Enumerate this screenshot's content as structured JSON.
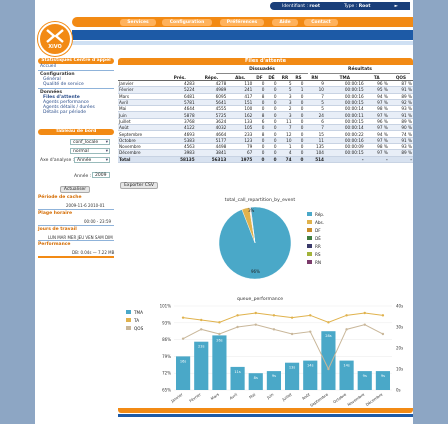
{
  "header": {
    "identified_label": "Identifiant :",
    "identified_user": "root",
    "type_label": "Type :",
    "type_value": "Root",
    "logo_text": "XiVO",
    "nav": [
      "Services",
      "Configuration",
      "Préférences",
      "Aide",
      "Contact"
    ]
  },
  "sidebar": {
    "title": "Statistiques Centre d'appel",
    "sections": [
      {
        "label": "Accueil",
        "items": []
      },
      {
        "label": "Configuration",
        "items": [
          "Général",
          "Qualité de service"
        ]
      },
      {
        "label": "Données",
        "items": [
          "Files d'attente",
          "Agents performance",
          "Agents détails / durées",
          "Détails par période"
        ]
      }
    ],
    "dashboard_title": "Tableau de bord",
    "conf_select": "conf_locale",
    "axis_select": "normal",
    "year_label": "Axe d'analyse :",
    "year_select": "Année",
    "annee_label": "Année :",
    "annee_value": "2009",
    "apply_button": "Actualiser",
    "info": [
      {
        "title": "Période de cache",
        "value": "2009-11-6 2010-01"
      },
      {
        "title": "Plage horaire",
        "value": "00:00 - 23:59"
      },
      {
        "title": "Jours de travail",
        "value": "LUN MAR MER JEU VEN SAM DIM"
      },
      {
        "title": "Performance",
        "value": "DB: 0.04s — 7.22 MB"
      }
    ]
  },
  "table": {
    "title": "Files d'attente",
    "group_headers": [
      "Dissuadés",
      "Résultats"
    ],
    "columns": [
      "",
      "Prés.",
      "Répo.",
      "Abs.",
      "DF",
      "DÉ",
      "RR",
      "RS",
      "RN",
      "TMA",
      "TA",
      "QOS"
    ],
    "rows": [
      [
        "Janvier",
        "4283",
        "4278",
        "110",
        "0",
        "0",
        "5",
        "0",
        "9",
        "00:00:16",
        "96 %",
        "87 %"
      ],
      [
        "Février",
        "5224",
        "4989",
        "241",
        "0",
        "0",
        "5",
        "1",
        "10",
        "00:00:15",
        "95 %",
        "91 %"
      ],
      [
        "Mars",
        "6481",
        "6095",
        "417",
        "8",
        "0",
        "3",
        "0",
        "7",
        "00:00:16",
        "94 %",
        "89 %"
      ],
      [
        "Avril",
        "5781",
        "5641",
        "151",
        "0",
        "0",
        "3",
        "0",
        "5",
        "00:00:15",
        "97 %",
        "92 %"
      ],
      [
        "Mai",
        "4644",
        "4555",
        "100",
        "0",
        "0",
        "2",
        "0",
        "5",
        "00:00:14",
        "98 %",
        "93 %"
      ],
      [
        "Juin",
        "5878",
        "5725",
        "162",
        "8",
        "0",
        "3",
        "0",
        "24",
        "00:00:11",
        "97 %",
        "91 %"
      ],
      [
        "Juillet",
        "3768",
        "3624",
        "133",
        "6",
        "0",
        "11",
        "0",
        "6",
        "00:00:15",
        "96 %",
        "89 %"
      ],
      [
        "Août",
        "4122",
        "4032",
        "105",
        "0",
        "0",
        "7",
        "0",
        "7",
        "00:00:14",
        "97 %",
        "90 %"
      ],
      [
        "Septembre",
        "4693",
        "4664",
        "233",
        "8",
        "0",
        "12",
        "0",
        "15",
        "00:00:22",
        "94 %",
        "74 %"
      ],
      [
        "Octobre",
        "5383",
        "5177",
        "123",
        "0",
        "0",
        "10",
        "0",
        "11",
        "00:00:16",
        "97 %",
        "91 %"
      ],
      [
        "Novembre",
        "4563",
        "4498",
        "79",
        "0",
        "0",
        "1",
        "0",
        "135",
        "00:00:09",
        "98 %",
        "93 %"
      ],
      [
        "Décembre",
        "3983",
        "3841",
        "67",
        "0",
        "0",
        "4",
        "0",
        "104",
        "00:00:15",
        "97 %",
        "89 %"
      ]
    ],
    "total": [
      "Total",
      "58135",
      "56313",
      "1975",
      "0",
      "0",
      "74",
      "0",
      "514",
      "-",
      "-",
      "-"
    ],
    "export_button": "Exporter CSV"
  },
  "pie": {
    "title": "total_call_repartition_by_event",
    "legend": [
      "Rép.",
      "Abs.",
      "DF",
      "DÉ",
      "RR",
      "RS",
      "RN"
    ],
    "colors": [
      "#4aa8c8",
      "#e0b24c",
      "#c98c2a",
      "#3f7d3f",
      "#3a3a6a",
      "#a2b33a",
      "#7a3a6a"
    ],
    "values": [
      96,
      3.4,
      0.1,
      0.1,
      0.1,
      0.1,
      0.2
    ],
    "big_label": "96%",
    "small_label": "3%"
  },
  "chart_data": {
    "type": "bar",
    "title": "queue_performance",
    "categories": [
      "Janvier",
      "Février",
      "Mars",
      "Avril",
      "Mai",
      "Juin",
      "Juillet",
      "Août",
      "Septembre",
      "Octobre",
      "Novembre",
      "Décembre"
    ],
    "series": [
      {
        "name": "TMA",
        "values": [
          16,
          23,
          26,
          11,
          8,
          9,
          13,
          14,
          28,
          14,
          9,
          9
        ]
      },
      {
        "name": "TA",
        "values": [
          96,
          95,
          94,
          97,
          98,
          97,
          96,
          97,
          94,
          97,
          98,
          97
        ]
      },
      {
        "name": "QOS",
        "values": [
          87,
          91,
          89,
          92,
          93,
          91,
          89,
          90,
          74,
          91,
          93,
          89
        ]
      }
    ],
    "colors": [
      "#4aa8c8",
      "#e0b24c",
      "#c9b79a"
    ],
    "y_left_ticks": [
      "101%",
      "93%",
      "86%",
      "79%",
      "72%",
      "65%"
    ],
    "y_right_ticks": [
      "40s",
      "30s",
      "20s",
      "10s",
      "0s"
    ],
    "bar_labels": [
      "16s",
      "23s",
      "26s",
      "11s",
      "8s",
      "9s",
      "13s",
      "14s",
      "28s",
      "14s",
      "9s",
      "9s"
    ]
  }
}
